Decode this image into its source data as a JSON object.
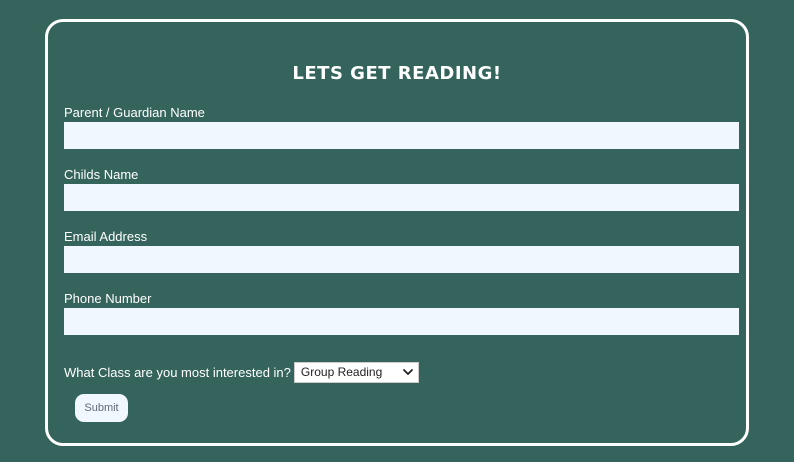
{
  "form": {
    "title": "LETS GET READING!",
    "fields": [
      {
        "label": "Parent / Guardian Name",
        "value": "",
        "placeholder": ""
      },
      {
        "label": "Childs Name",
        "value": "",
        "placeholder": ""
      },
      {
        "label": "Email Address",
        "value": "",
        "placeholder": ""
      },
      {
        "label": "Phone Number",
        "value": "",
        "placeholder": ""
      }
    ],
    "class_question": "What Class are you most interested in?",
    "class_select": {
      "selected": "Group Reading",
      "icon": "chevron-down-icon"
    },
    "submit_label": "Submit"
  },
  "colors": {
    "background": "#35645c",
    "card_border": "#ffffff",
    "input_background": "#f0f7ff",
    "text": "#ffffff"
  }
}
